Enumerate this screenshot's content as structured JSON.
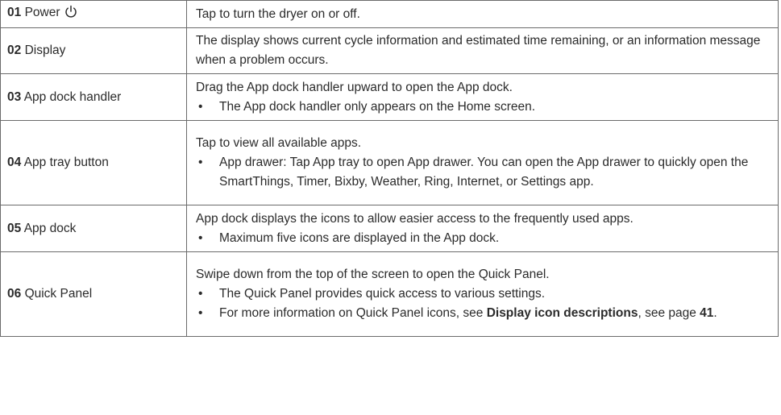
{
  "rows": [
    {
      "number": "01",
      "name": "Power",
      "description": "Tap to turn the dryer on or off.",
      "bullets": []
    },
    {
      "number": "02",
      "name": "Display",
      "description": "The display shows current cycle information and estimated time remaining, or an information message when a problem occurs.",
      "bullets": []
    },
    {
      "number": "03",
      "name": "App dock handler",
      "description": "Drag the App dock handler upward to open the App dock.",
      "bullets": [
        "The App dock handler only appears on the Home screen."
      ]
    },
    {
      "number": "04",
      "name": "App tray button",
      "description": "Tap to view all available apps.",
      "bullets": [
        "App drawer: Tap App tray to open App drawer. You can open the App drawer to quickly open the SmartThings, Timer, Bixby, Weather, Ring, Internet, or Settings app."
      ]
    },
    {
      "number": "05",
      "name": "App dock",
      "description": "App dock displays the icons to allow easier access to the frequently used apps.",
      "bullets": [
        "Maximum five icons are displayed in the App dock."
      ]
    },
    {
      "number": "06",
      "name": "Quick Panel",
      "description": "Swipe down from the top of the screen to open the Quick Panel.",
      "bullets": [
        "The Quick Panel provides quick access to various settings.",
        {
          "before": "For more information on Quick Panel icons, see ",
          "link": "Display icon descriptions",
          "middle": ", see page ",
          "page": "41",
          "after": "."
        }
      ]
    }
  ],
  "bullet_char": "•",
  "icons": {
    "power": "power-icon"
  }
}
